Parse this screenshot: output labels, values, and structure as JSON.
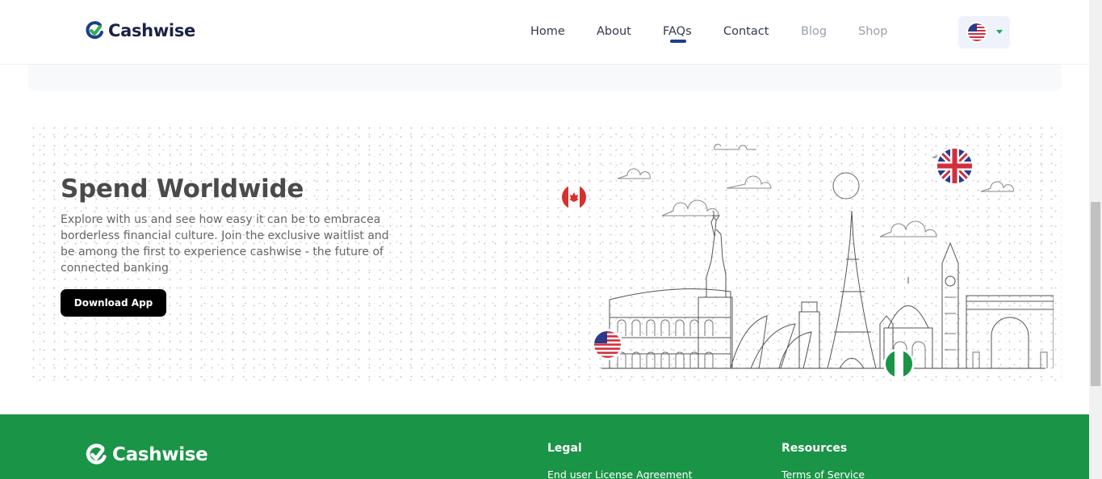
{
  "brand": {
    "name": "Cashwise",
    "logo_icon": "cashwise-logo-icon"
  },
  "nav": {
    "items": [
      {
        "label": "Home"
      },
      {
        "label": "About"
      },
      {
        "label": "FAQs"
      },
      {
        "label": "Contact"
      },
      {
        "label": "Blog"
      },
      {
        "label": "Shop"
      }
    ],
    "active": "FAQs",
    "language_icon": "us-flag-icon"
  },
  "hero": {
    "title": "Spend Worldwide",
    "text": "Explore with us and see how easy it can be to embracea borderless financial culture. Join the exclusive waitlist and be among the first to experience cashwise - the future of connected banking",
    "button_label": "Download App",
    "flag_icons": [
      "canada-flag-icon",
      "uk-flag-icon",
      "us-flag-icon",
      "nigeria-flag-icon"
    ]
  },
  "footer": {
    "brand": "Cashwise",
    "columns": [
      {
        "heading": "Legal",
        "first_link": "End user License Agreement"
      },
      {
        "heading": "Resources",
        "first_link": "Terms of Service"
      }
    ]
  },
  "colors": {
    "brand_green": "#1a9447",
    "nav_text": "#333a4d",
    "nav_active_underline": "#1a3f8c",
    "button_black": "#000000"
  }
}
